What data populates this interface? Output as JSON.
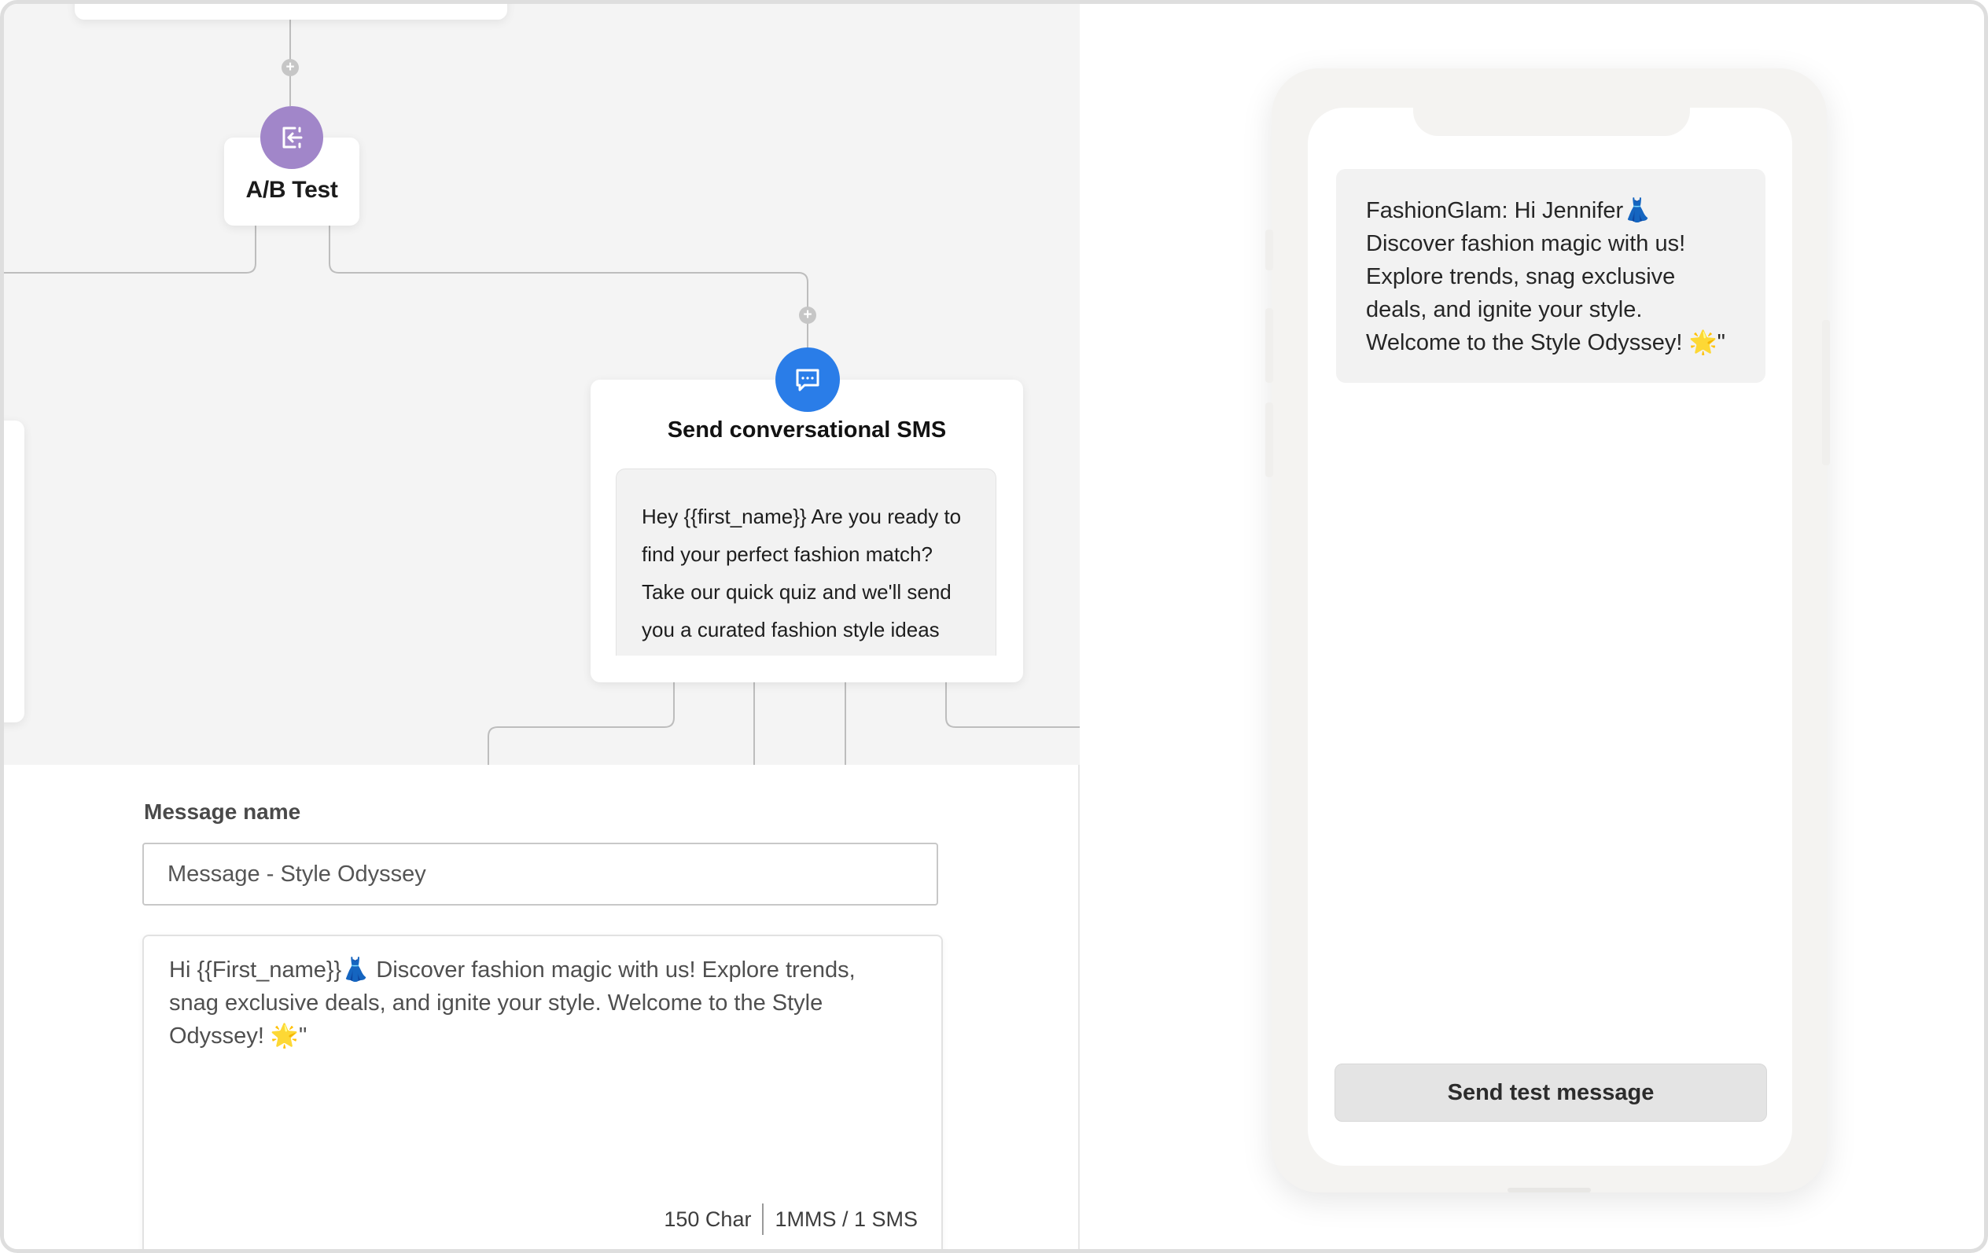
{
  "flow": {
    "ab_test": {
      "title": "A/B Test"
    },
    "sms_node": {
      "title": "Send conversational SMS",
      "preview_text": "Hey {{first_name}} Are you ready to find your perfect fashion match? Take our quick quiz and we'll send you a curated fashion style ideas"
    },
    "plus_symbol": "+"
  },
  "editor": {
    "message_name_label": "Message name",
    "message_name_value": "Message - Style Odyssey",
    "message_body": "Hi {{First_name}}👗 Discover fashion magic with us! Explore trends, snag exclusive deals, and ignite your style. Welcome to the Style Odyssey! 🌟\"",
    "char_count": "150 Char",
    "segment_count": "1MMS / 1 SMS"
  },
  "phone": {
    "message_text": "FashionGlam: Hi Jennifer👗 Discover fashion magic with us! Explore trends, snag exclusive deals, and ignite your style. Welcome to the Style Odyssey! 🌟\"",
    "send_test_label": "Send test message"
  },
  "colors": {
    "ab_icon": "#a186c9",
    "sms_icon": "#2a7de8",
    "canvas_bg": "#f4f4f4"
  },
  "icons": {
    "ab_test": "exit-arrow-icon",
    "sms": "chat-bubble-icon",
    "add": "plus-icon"
  }
}
